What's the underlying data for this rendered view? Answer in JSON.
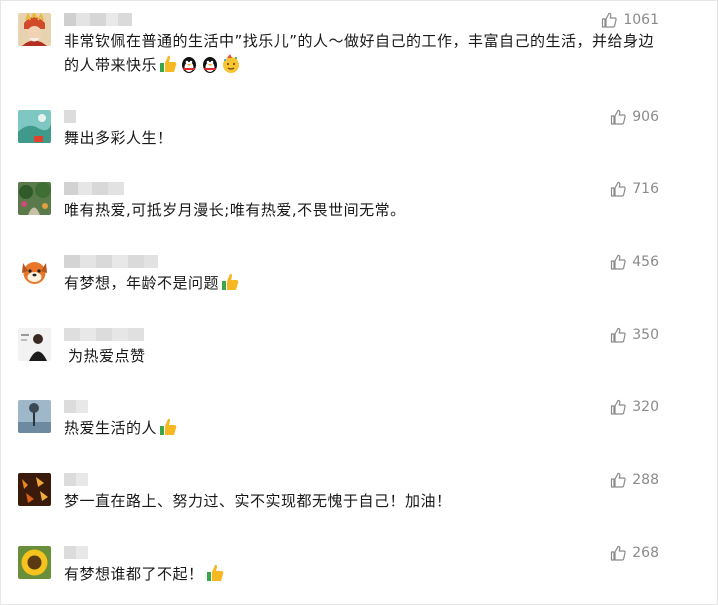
{
  "comments": [
    {
      "text": "非常钦佩在普通的生活中”找乐儿”的人～做好自己的工作，丰富自己的生活，并给身边的人带来快乐",
      "likes": "1061",
      "avatar": "monk-avatar",
      "emojis": [
        "thumbs-up-emoji",
        "penguin-emoji",
        "penguin-emoji",
        "party-face-emoji"
      ]
    },
    {
      "text": "舞出多彩人生！",
      "likes": "906",
      "avatar": "landscape-avatar",
      "emojis": []
    },
    {
      "text": "唯有热爱,可抵岁月漫长;唯有热爱,不畏世间无常。",
      "likes": "716",
      "avatar": "garden-avatar",
      "emojis": []
    },
    {
      "text": "有梦想，年龄不是问题",
      "likes": "456",
      "avatar": "cartoon-dog-avatar",
      "emojis": [
        "thumbs-up-emoji"
      ]
    },
    {
      "text": "为热爱点赞",
      "likes": "350",
      "avatar": "portrait-avatar",
      "emojis": []
    },
    {
      "text": "热爱生活的人",
      "likes": "320",
      "avatar": "tree-avatar",
      "emojis": [
        "thumbs-up-emoji"
      ]
    },
    {
      "text": "梦一直在路上、努力过、实不实现都无愧于自己！加油！",
      "likes": "288",
      "avatar": "autumn-leaves-avatar",
      "emojis": []
    },
    {
      "text": "有梦想谁都了不起！",
      "likes": "268",
      "avatar": "sunflower-avatar",
      "emojis": [
        "thumbs-up-emoji"
      ]
    }
  ],
  "colors": {
    "like_text": "#8a8a8a",
    "body_text": "#191919",
    "nick_blur": "#d9d9d9"
  }
}
